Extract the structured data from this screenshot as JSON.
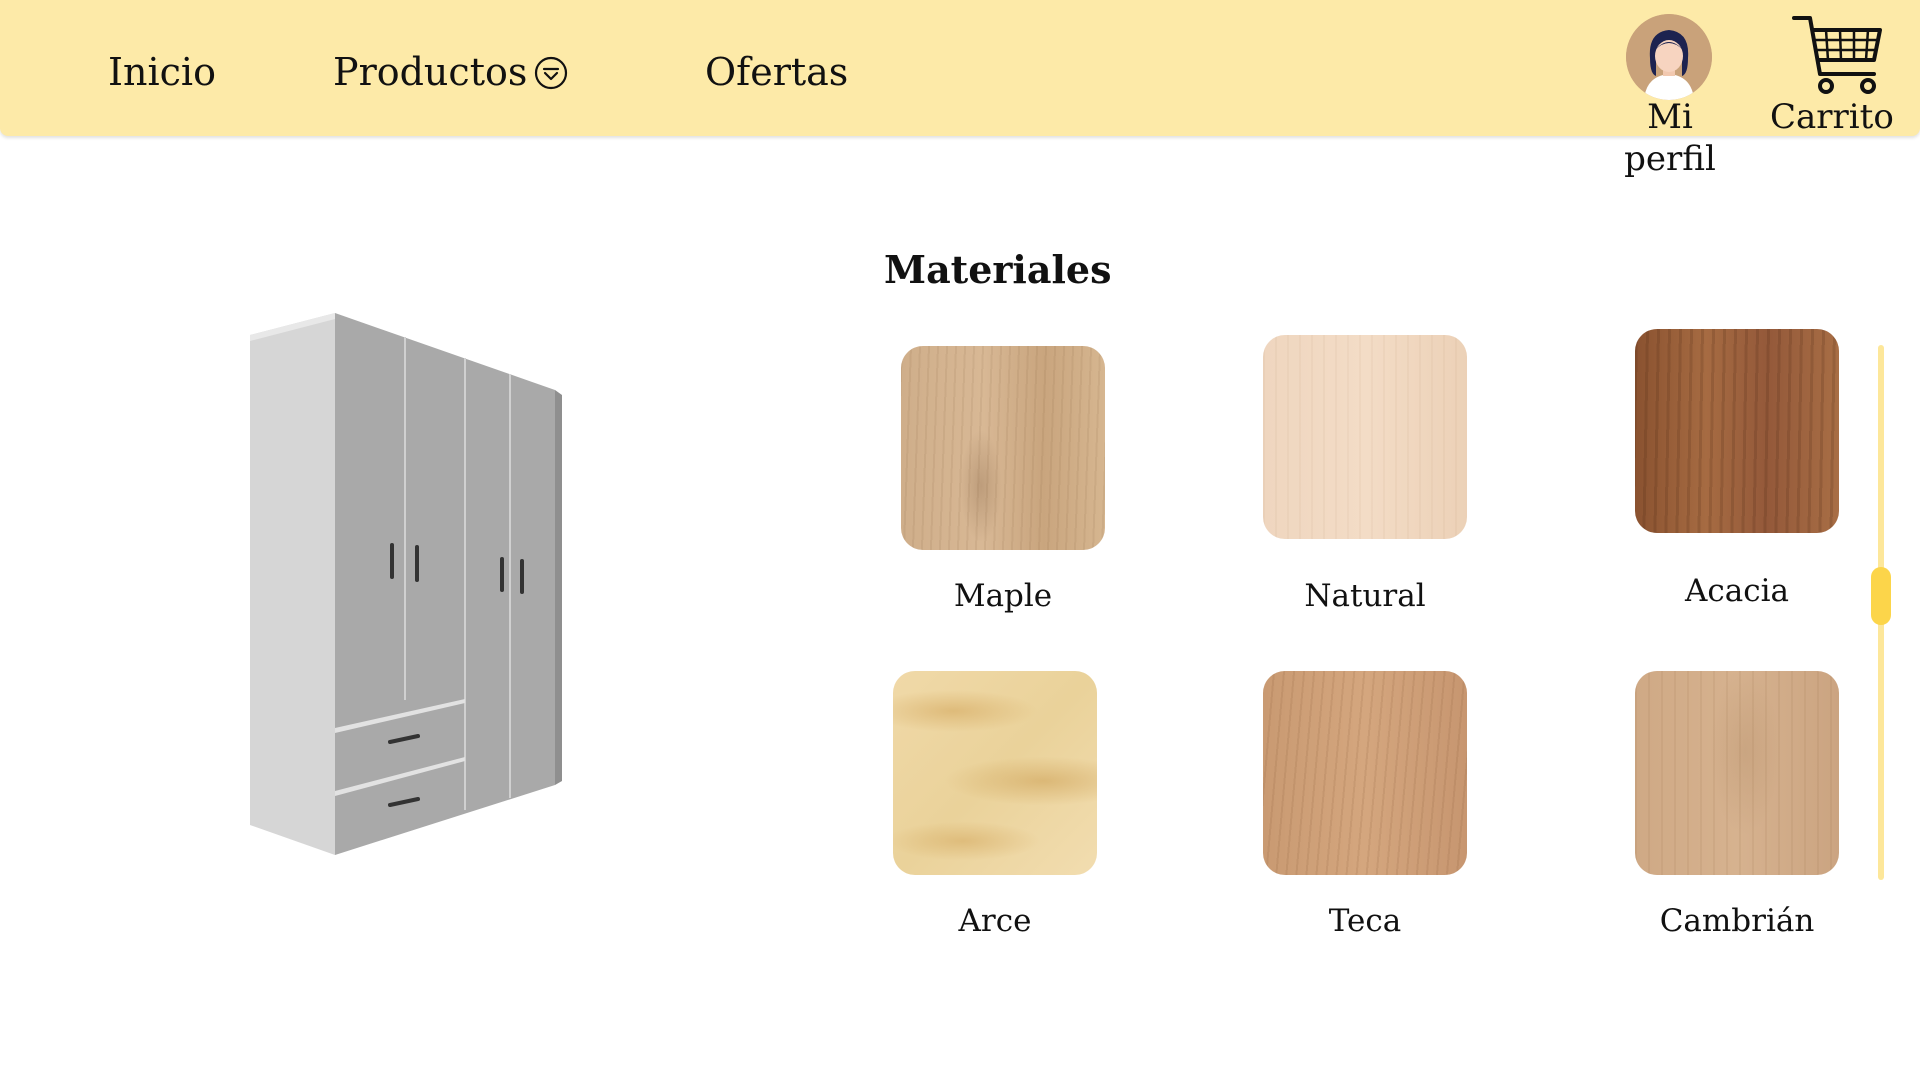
{
  "nav": {
    "links": [
      {
        "label": "Inicio"
      },
      {
        "label": "Productos"
      },
      {
        "label": "Ofertas"
      }
    ],
    "productos_icon": "chevron-down-circle-icon",
    "profile_label": "Mi perfil",
    "profile_icon": "avatar",
    "cart_label": "Carrito",
    "cart_icon": "shopping-cart-icon"
  },
  "product": {
    "image": "wardrobe-image"
  },
  "materials": {
    "title": "Materiales",
    "items": [
      {
        "label": "Maple"
      },
      {
        "label": "Natural"
      },
      {
        "label": "Acacia"
      },
      {
        "label": "Arce"
      },
      {
        "label": "Teca"
      },
      {
        "label": "Cambrián"
      }
    ]
  },
  "colors": {
    "navbar_bg": "#fdeaa8",
    "scroll_track": "#fde79a",
    "scroll_thumb": "#fcd54a"
  }
}
